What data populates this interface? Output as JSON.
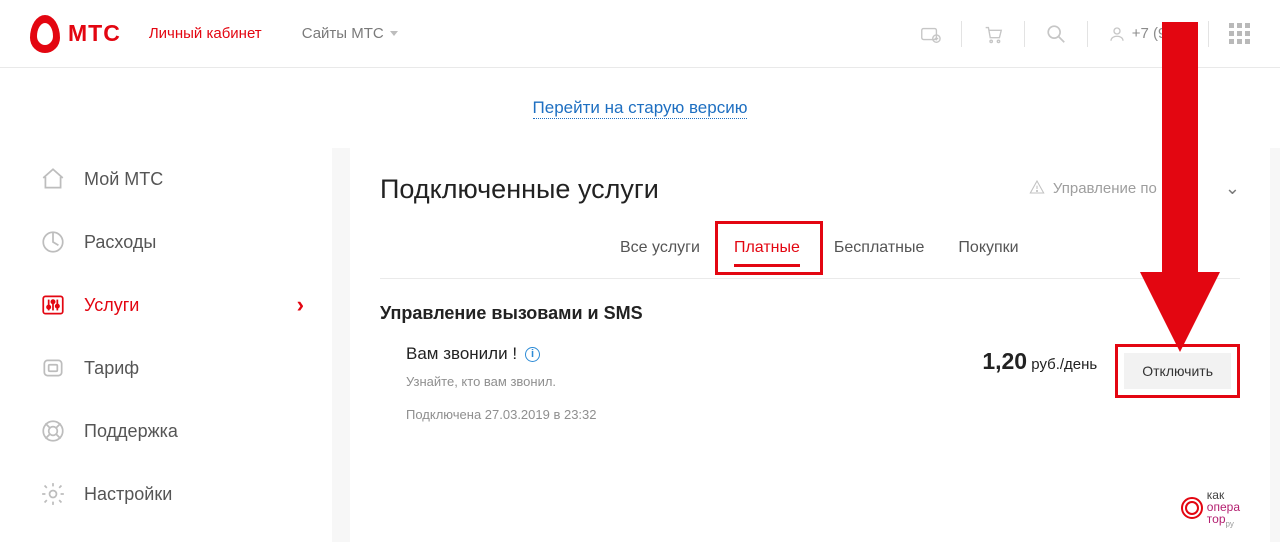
{
  "header": {
    "brand": "МТС",
    "lk": "Личный кабинет",
    "sites": "Сайты МТС",
    "phone": "+7 (917)"
  },
  "old_version_link": "Перейти на старую версию",
  "sidebar": {
    "items": [
      {
        "label": "Мой МТС"
      },
      {
        "label": "Расходы"
      },
      {
        "label": "Услуги"
      },
      {
        "label": "Тариф"
      },
      {
        "label": "Поддержка"
      },
      {
        "label": "Настройки"
      }
    ]
  },
  "main": {
    "title": "Подключенные услуги",
    "manage_label": "Управление по",
    "tabs": [
      {
        "label": "Все услуги"
      },
      {
        "label": "Платные"
      },
      {
        "label": "Бесплатные"
      },
      {
        "label": "Покупки"
      }
    ],
    "section_title": "Управление вызовами и SMS",
    "service": {
      "name": "Вам звонили !",
      "desc": "Узнайте, кто вам звонил.",
      "date": "Подключена 27.03.2019 в 23:32",
      "price_num": "1,20",
      "price_unit": "руб./день",
      "disable_label": "Отключить"
    }
  },
  "watermark": {
    "l1": "как",
    "l2": "опера",
    "l3": "тор",
    "suf": "ру"
  }
}
